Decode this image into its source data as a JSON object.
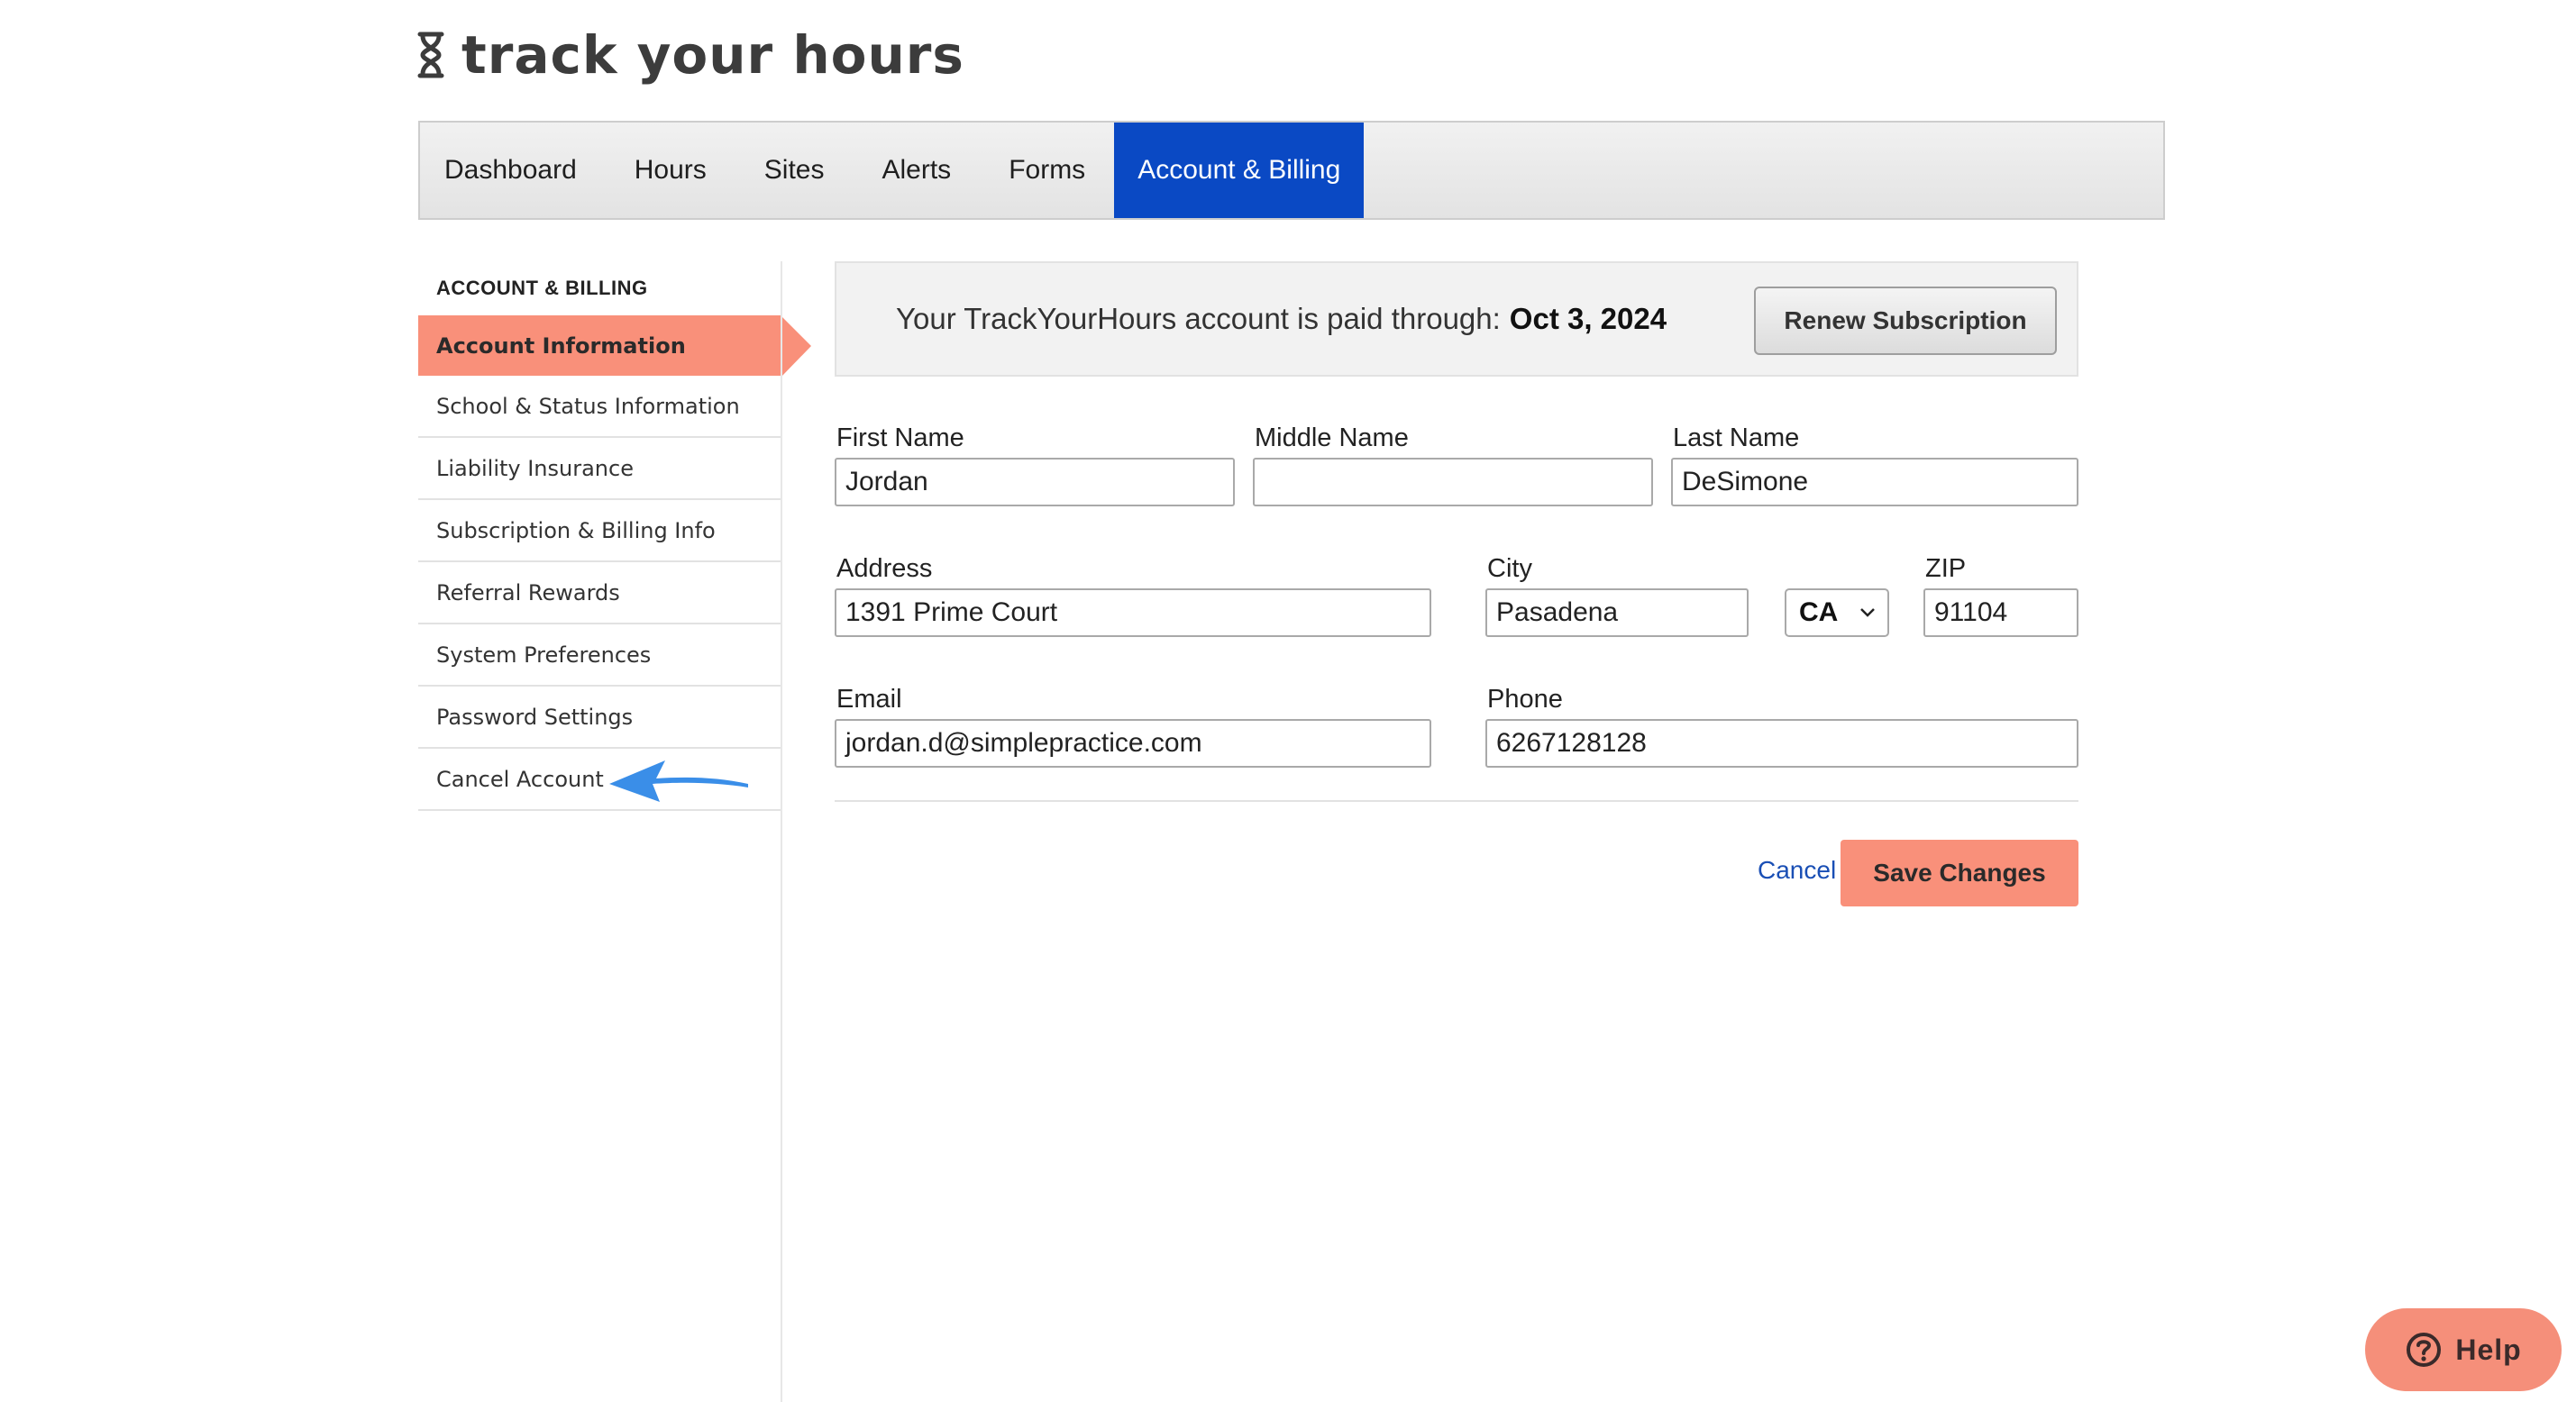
{
  "app": {
    "logo_text": "track your hours"
  },
  "nav": {
    "items": [
      {
        "label": "Dashboard"
      },
      {
        "label": "Hours"
      },
      {
        "label": "Sites"
      },
      {
        "label": "Alerts"
      },
      {
        "label": "Forms"
      },
      {
        "label": "Account & Billing",
        "active": true
      }
    ]
  },
  "sidebar": {
    "title": "ACCOUNT & BILLING",
    "items": [
      {
        "label": "Account Information",
        "active": true
      },
      {
        "label": "School & Status Information"
      },
      {
        "label": "Liability Insurance"
      },
      {
        "label": "Subscription & Billing Info"
      },
      {
        "label": "Referral Rewards"
      },
      {
        "label": "System Preferences"
      },
      {
        "label": "Password Settings"
      },
      {
        "label": "Cancel Account"
      }
    ]
  },
  "banner": {
    "text": "Your TrackYourHours account is paid through:",
    "date": "Oct 3, 2024",
    "renew_label": "Renew Subscription"
  },
  "form": {
    "first_name": {
      "label": "First Name",
      "value": "Jordan"
    },
    "middle_name": {
      "label": "Middle Name",
      "value": ""
    },
    "last_name": {
      "label": "Last Name",
      "value": "DeSimone"
    },
    "address": {
      "label": "Address",
      "value": "1391 Prime Court"
    },
    "city": {
      "label": "City",
      "value": "Pasadena"
    },
    "state": {
      "value": "CA"
    },
    "zip": {
      "label": "ZIP",
      "value": "91104"
    },
    "email": {
      "label": "Email",
      "value": "jordan.d@simplepractice.com"
    },
    "phone": {
      "label": "Phone",
      "value": "6267128128"
    }
  },
  "actions": {
    "cancel_label": "Cancel",
    "save_label": "Save Changes"
  },
  "help": {
    "label": "Help"
  },
  "colors": {
    "accent": "#f9907a",
    "nav_active": "#0a49c4",
    "link": "#1a4fb5",
    "annotation_arrow": "#3a8ee8"
  },
  "annotation": {
    "arrow_icon": "left-arrow-icon"
  }
}
